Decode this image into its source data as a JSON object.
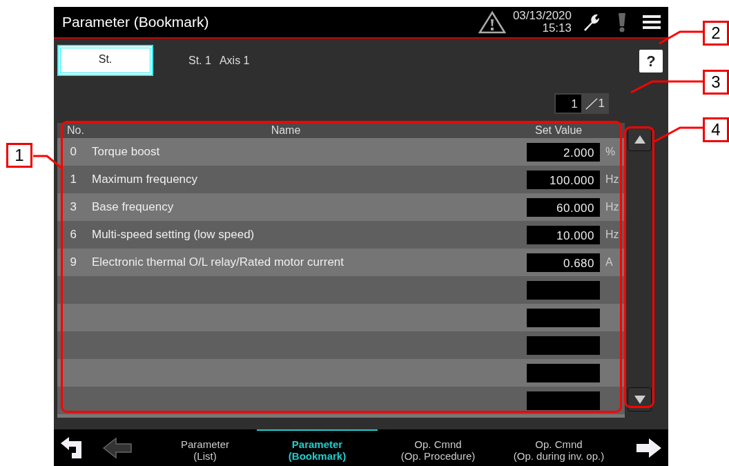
{
  "title_bar": {
    "title": "Parameter (Bookmark)",
    "date": "03/13/2020",
    "time": "15:13"
  },
  "station": {
    "button": "St.",
    "station": "St. 1",
    "axis": "Axis 1"
  },
  "help": {
    "label": "?"
  },
  "page": {
    "current": "1",
    "total": "1"
  },
  "table": {
    "columns": [
      "No.",
      "Name",
      "Set Value"
    ],
    "rows": [
      {
        "kind": "param",
        "no": "0",
        "name": "Torque boost",
        "value": "2.000",
        "unit": "%"
      },
      {
        "kind": "param",
        "no": "1",
        "name": "Maximum frequency",
        "value": "100.000",
        "unit": "Hz"
      },
      {
        "kind": "param",
        "no": "3",
        "name": "Base frequency",
        "value": "60.000",
        "unit": "Hz"
      },
      {
        "kind": "param",
        "no": "6",
        "name": "Multi-speed setting (low speed)",
        "value": "10.000",
        "unit": "Hz"
      },
      {
        "kind": "param",
        "no": "9",
        "name": "Electronic thermal O/L relay/Rated motor current",
        "value": "0.680",
        "unit": "A"
      },
      {
        "kind": "blank"
      },
      {
        "kind": "blank"
      },
      {
        "kind": "blank"
      },
      {
        "kind": "blank"
      },
      {
        "kind": "blank"
      }
    ]
  },
  "nav_tabs": [
    {
      "line1": "Parameter",
      "line2": "(List)",
      "selected": false
    },
    {
      "line1": "Parameter",
      "line2": "(Bookmark)",
      "selected": true
    },
    {
      "line1": "Op. Cmnd",
      "line2": "(Op. Procedure)",
      "selected": false
    },
    {
      "line1": "Op. Cmnd",
      "line2": "(Op. during inv. op.)",
      "selected": false
    }
  ],
  "callouts": [
    {
      "label": "1"
    },
    {
      "label": "2"
    },
    {
      "label": "3"
    },
    {
      "label": "4"
    }
  ]
}
